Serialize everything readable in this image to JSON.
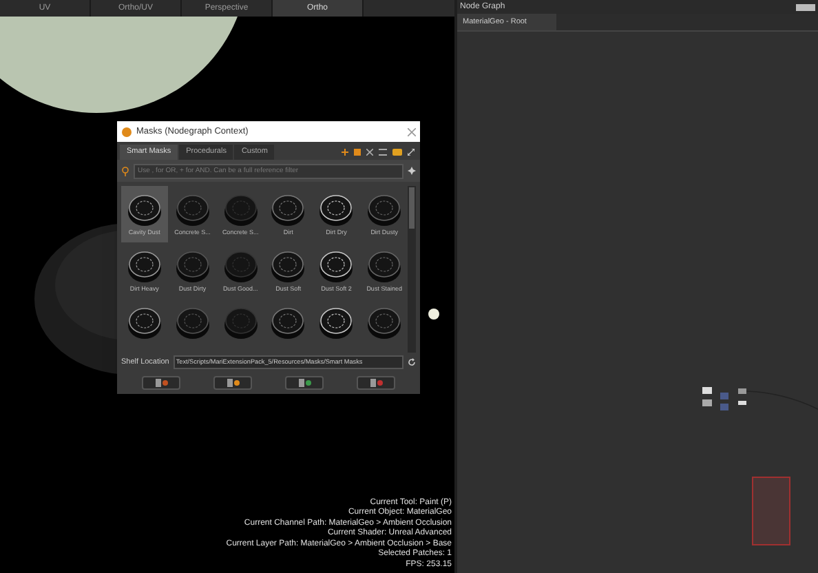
{
  "viewport": {
    "tabs": [
      {
        "label": "UV",
        "selected": false
      },
      {
        "label": "Ortho/UV",
        "selected": false
      },
      {
        "label": "Perspective",
        "selected": false
      },
      {
        "label": "Ortho",
        "selected": true
      }
    ],
    "status_lines": [
      "Current Tool: Paint (P)",
      "Current Object: MaterialGeo",
      "Current Channel Path: MaterialGeo > Ambient Occlusion",
      "Current Shader: Unreal Advanced",
      "Current Layer Path: MaterialGeo > Ambient Occlusion > Base",
      "Selected Patches: 1",
      "FPS: 253.15"
    ]
  },
  "masks_dialog": {
    "title": "Masks (Nodegraph Context)",
    "tabs": [
      {
        "label": "Smart Masks",
        "selected": true
      },
      {
        "label": "Procedurals",
        "selected": false
      },
      {
        "label": "Custom",
        "selected": false
      }
    ],
    "search": {
      "placeholder": "Use , for OR, + for AND. Can be a full reference filter"
    },
    "items": [
      {
        "label": "Cavity Dust",
        "selected": true
      },
      {
        "label": "Concrete S...",
        "selected": false
      },
      {
        "label": "Concrete S...",
        "selected": false
      },
      {
        "label": "Dirt",
        "selected": false
      },
      {
        "label": "Dirt Dry",
        "selected": false
      },
      {
        "label": "Dirt Dusty",
        "selected": false
      },
      {
        "label": "Dirt Heavy",
        "selected": false
      },
      {
        "label": "Dust Dirty",
        "selected": false
      },
      {
        "label": "Dust Good...",
        "selected": false
      },
      {
        "label": "Dust Soft",
        "selected": false
      },
      {
        "label": "Dust Soft 2",
        "selected": false
      },
      {
        "label": "Dust Stained",
        "selected": false
      },
      {
        "selected": false
      },
      {
        "selected": false
      },
      {
        "selected": false
      },
      {
        "selected": false
      },
      {
        "selected": false
      },
      {
        "selected": false
      }
    ],
    "shelf_location": {
      "label": "Shelf Location",
      "value": "Text/Scripts/MariExtensionPack_5/Resources/Masks/Smart Masks"
    }
  },
  "node_graph": {
    "title": "Node Graph",
    "tab": "MaterialGeo - Root"
  }
}
